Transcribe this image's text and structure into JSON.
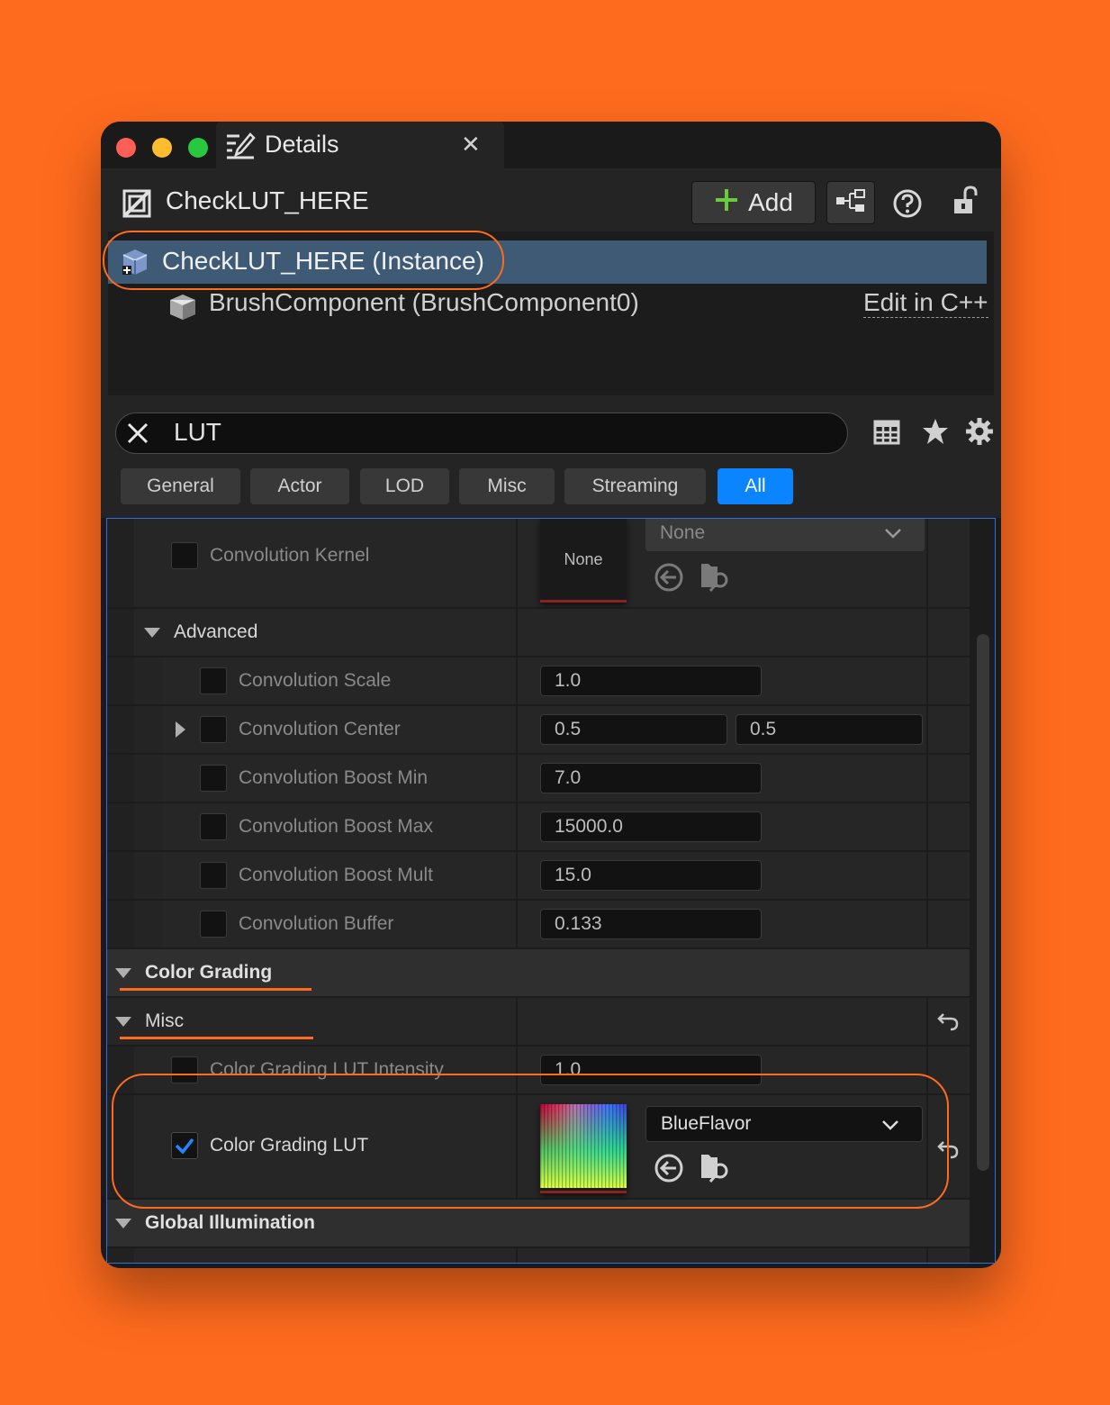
{
  "window": {
    "tab_title": "Details",
    "tab_close": "✕"
  },
  "header": {
    "actor_name": "CheckLUT_HERE",
    "add_label": "Add"
  },
  "tree": {
    "selected": "CheckLUT_HERE (Instance)",
    "component": "BrushComponent (BrushComponent0)",
    "edit_link": "Edit in C++"
  },
  "search": {
    "value": "LUT"
  },
  "filters": [
    "General",
    "Actor",
    "LOD",
    "Misc",
    "Streaming",
    "All"
  ],
  "active_filter": "All",
  "properties": {
    "convolution_kernel": {
      "label": "Convolution Kernel",
      "thumb": "None",
      "dropdown": "None"
    },
    "advanced": {
      "label": "Advanced"
    },
    "convolution_scale": {
      "label": "Convolution Scale",
      "value": "1.0"
    },
    "convolution_center": {
      "label": "Convolution Center",
      "x": "0.5",
      "y": "0.5"
    },
    "convolution_boost_min": {
      "label": "Convolution Boost Min",
      "value": "7.0"
    },
    "convolution_boost_max": {
      "label": "Convolution Boost Max",
      "value": "15000.0"
    },
    "convolution_boost_mult": {
      "label": "Convolution Boost Mult",
      "value": "15.0"
    },
    "convolution_buffer": {
      "label": "Convolution Buffer",
      "value": "0.133"
    },
    "color_grading": {
      "label": "Color Grading"
    },
    "misc": {
      "label": "Misc"
    },
    "lut_intensity": {
      "label": "Color Grading LUT Intensity",
      "value": "1.0"
    },
    "lut": {
      "label": "Color Grading LUT",
      "dropdown": "BlueFlavor",
      "checked": true
    },
    "global_illumination": {
      "label": "Global Illumination"
    }
  },
  "colors": {
    "accent_blue": "#0A84FF",
    "selection": "#3E5A75",
    "annotation": "#FF6B1E",
    "background": "#FF6B1E"
  }
}
